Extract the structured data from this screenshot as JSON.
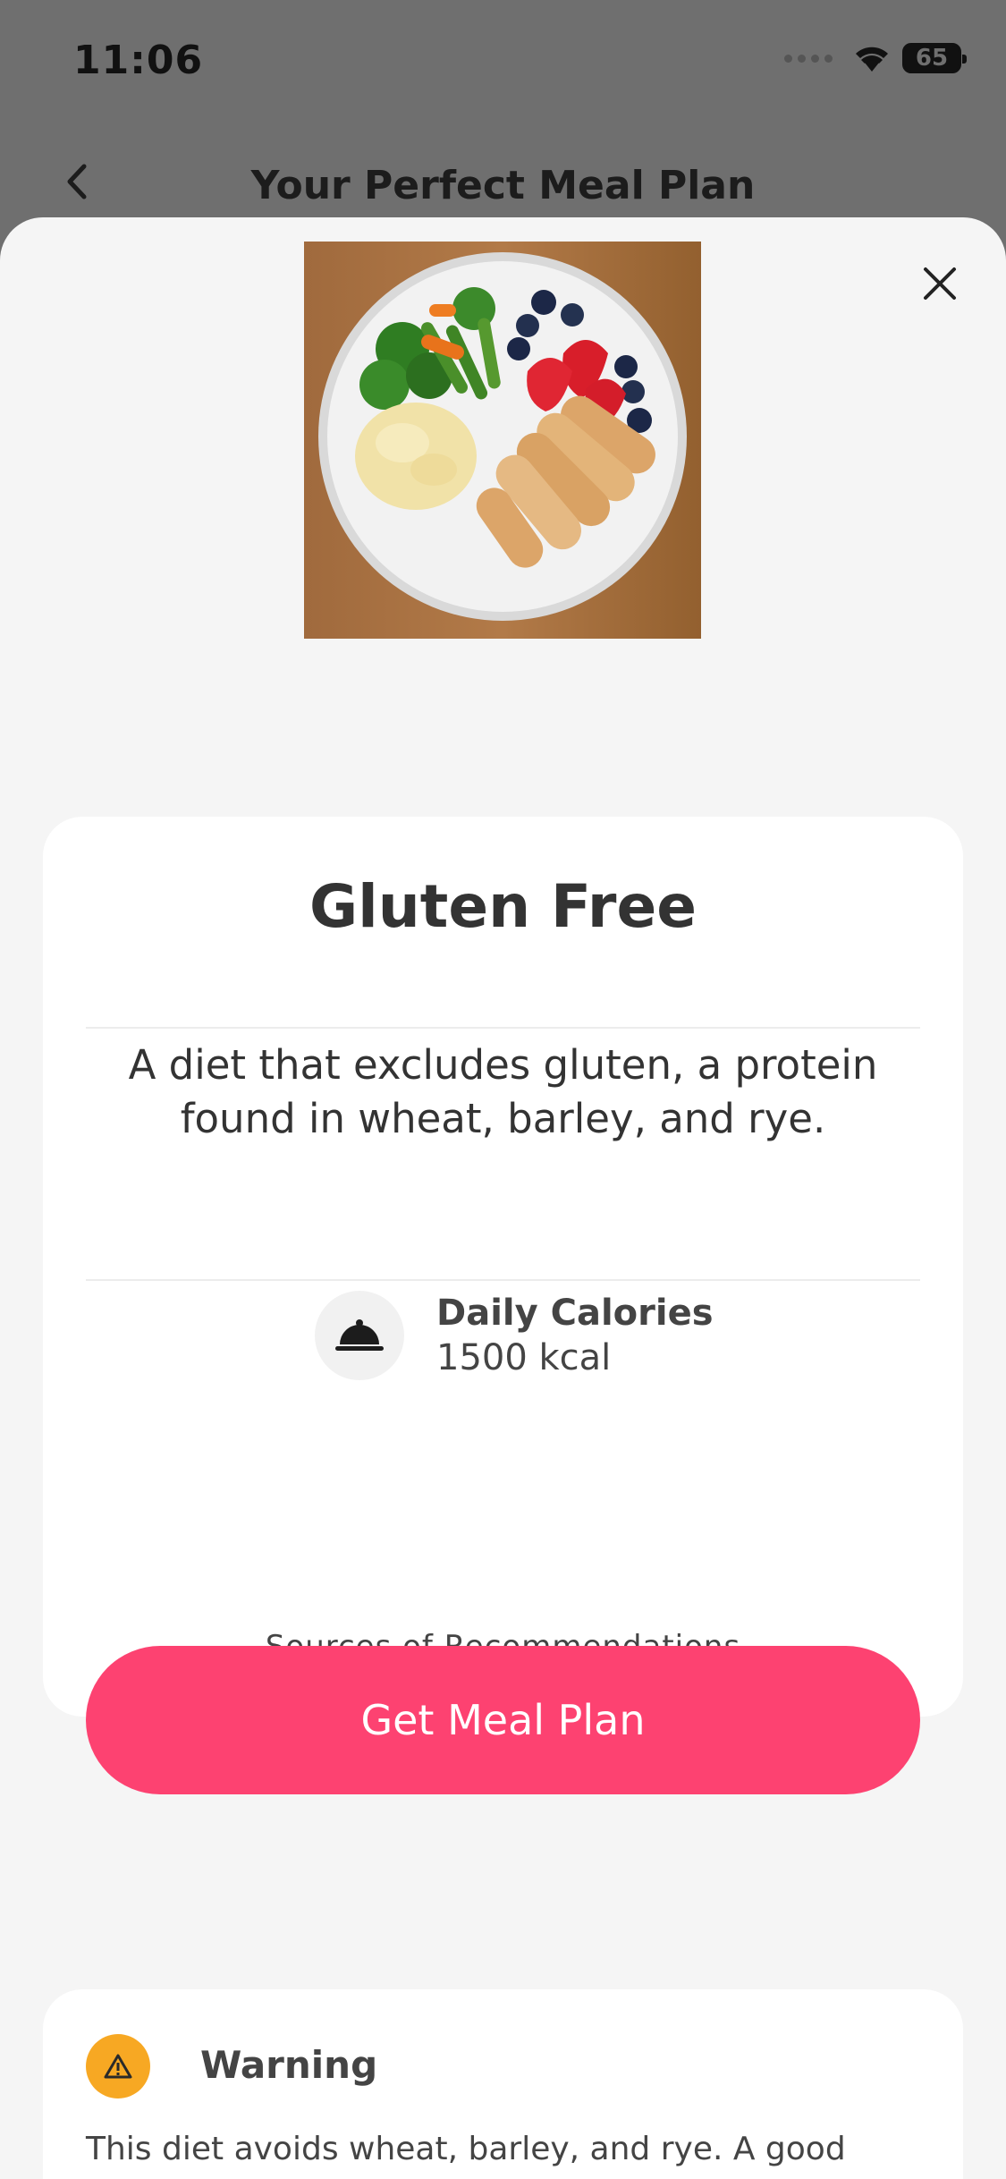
{
  "status_bar": {
    "time": "11:06",
    "battery": "65"
  },
  "nav": {
    "title": "Your Perfect Meal Plan"
  },
  "diet": {
    "title": "Gluten Free",
    "description": "A diet that excludes gluten, a protein found in wheat, barley, and rye.",
    "calories_label": "Daily Calories",
    "calories_value": "1500 kcal",
    "cta_label": "Get Meal Plan",
    "sources_label": "Sources of Recommendations"
  },
  "warning": {
    "title": "Warning",
    "text": "This diet avoids wheat, barley, and rye. A good"
  },
  "colors": {
    "accent": "#fd4271",
    "warning": "#f7a823",
    "sheet_bg": "#f5f5f5",
    "overlay": "#6f6f6f"
  }
}
